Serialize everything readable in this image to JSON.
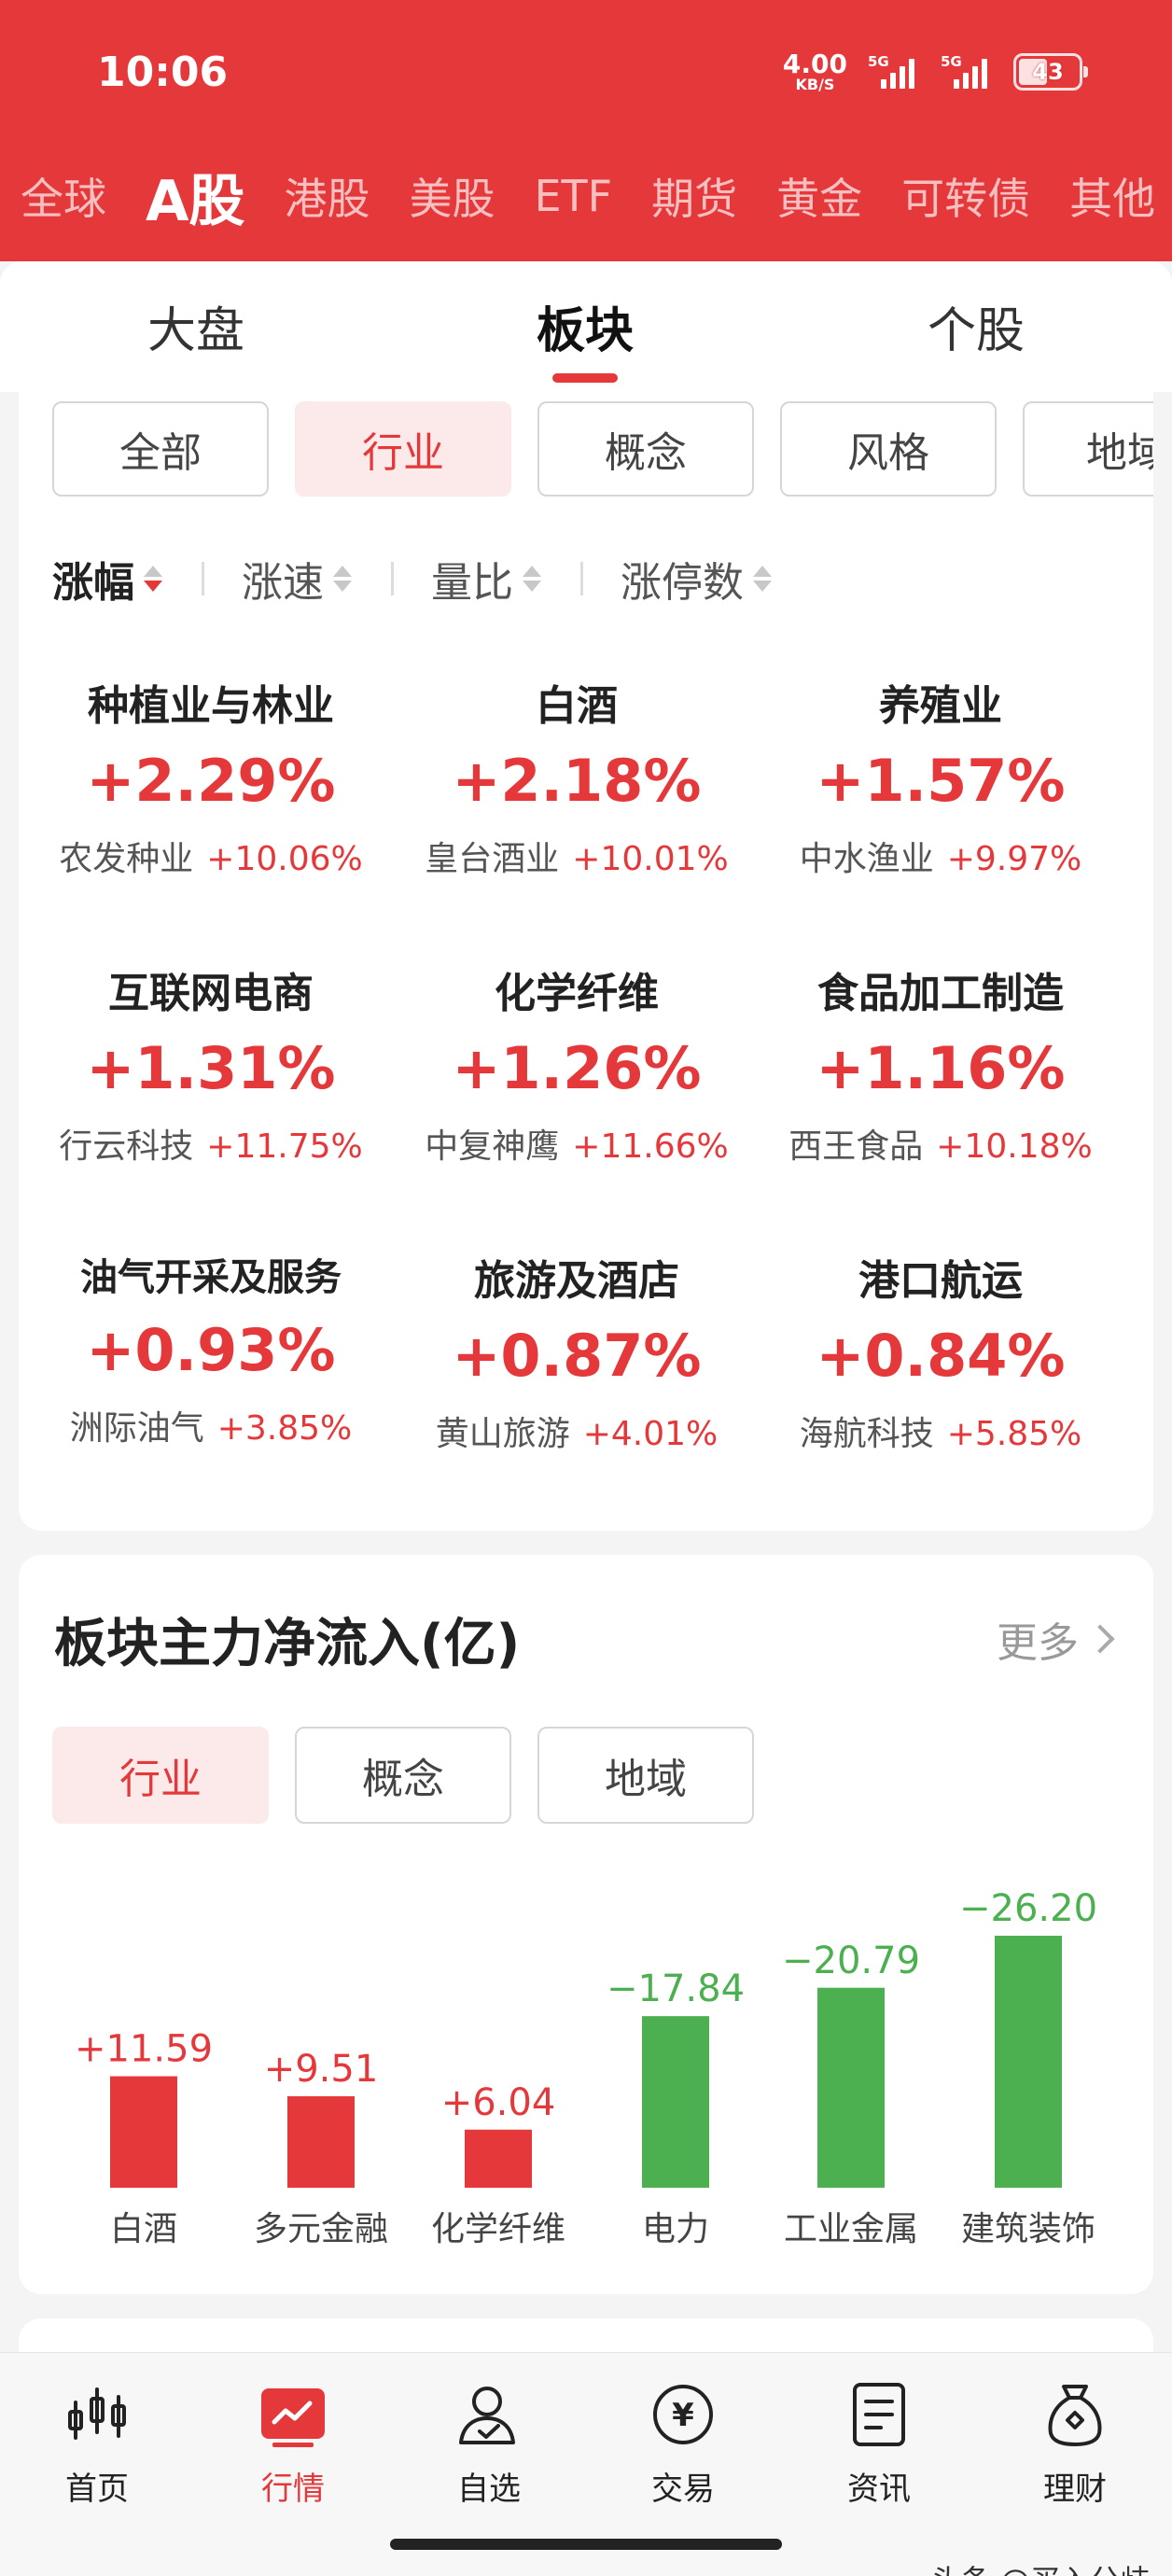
{
  "status_bar": {
    "time": "10:06",
    "net_speed": "4.00",
    "net_unit": "KB/S",
    "sim1_label": "5G",
    "sim2_label": "5G",
    "battery": "43"
  },
  "market_tabs": [
    "全球",
    "A股",
    "港股",
    "美股",
    "ETF",
    "期货",
    "黄金",
    "可转债",
    "其他"
  ],
  "market_active_index": 1,
  "sub_tabs": [
    "大盘",
    "板块",
    "个股"
  ],
  "sub_active_index": 1,
  "filter_chips": [
    "全部",
    "行业",
    "概念",
    "风格",
    "地域"
  ],
  "filter_active_index": 1,
  "sort_options": [
    "涨幅",
    "涨速",
    "量比",
    "涨停数"
  ],
  "sort_active_index": 0,
  "sectors": [
    {
      "name": "种植业与林业",
      "pct": "+2.29%",
      "leader": "农发种业",
      "leader_pct": "+10.06%"
    },
    {
      "name": "白酒",
      "pct": "+2.18%",
      "leader": "皇台酒业",
      "leader_pct": "+10.01%"
    },
    {
      "name": "养殖业",
      "pct": "+1.57%",
      "leader": "中水渔业",
      "leader_pct": "+9.97%"
    },
    {
      "name": "互联网电商",
      "pct": "+1.31%",
      "leader": "行云科技",
      "leader_pct": "+11.75%"
    },
    {
      "name": "化学纤维",
      "pct": "+1.26%",
      "leader": "中复神鹰",
      "leader_pct": "+11.66%"
    },
    {
      "name": "食品加工制造",
      "pct": "+1.16%",
      "leader": "西王食品",
      "leader_pct": "+10.18%"
    },
    {
      "name": "油气开采及服务",
      "pct": "+0.93%",
      "leader": "洲际油气",
      "leader_pct": "+3.85%"
    },
    {
      "name": "旅游及酒店",
      "pct": "+0.87%",
      "leader": "黄山旅游",
      "leader_pct": "+4.01%"
    },
    {
      "name": "港口航运",
      "pct": "+0.84%",
      "leader": "海航科技",
      "leader_pct": "+5.85%"
    }
  ],
  "net_inflow": {
    "title": "板块主力净流入(亿)",
    "more": "更多",
    "tabs": [
      "行业",
      "概念",
      "地域"
    ],
    "active_index": 0
  },
  "chart_data": {
    "type": "bar",
    "categories": [
      "白酒",
      "多元金融",
      "化学纤维",
      "电力",
      "工业金属",
      "建筑装饰"
    ],
    "values": [
      11.59,
      9.51,
      6.04,
      -17.84,
      -20.79,
      -26.2
    ],
    "labels": [
      "+11.59",
      "+9.51",
      "+6.04",
      "−17.84",
      "−20.79",
      "−26.20"
    ],
    "title": "板块主力净流入(亿)",
    "colors": {
      "positive": "#e5383b",
      "negative": "#4caf50"
    }
  },
  "bottom_nav": [
    {
      "label": "首页",
      "icon": "candlestick-icon"
    },
    {
      "label": "行情",
      "icon": "market-chart-icon"
    },
    {
      "label": "自选",
      "icon": "user-star-icon"
    },
    {
      "label": "交易",
      "icon": "yuan-coin-icon"
    },
    {
      "label": "资讯",
      "icon": "document-icon"
    },
    {
      "label": "理财",
      "icon": "money-bag-icon"
    }
  ],
  "bottom_active_index": 1,
  "watermark": "头条 @买入分歧",
  "colors": {
    "brand_red": "#e5383b",
    "down_green": "#4caf50"
  }
}
